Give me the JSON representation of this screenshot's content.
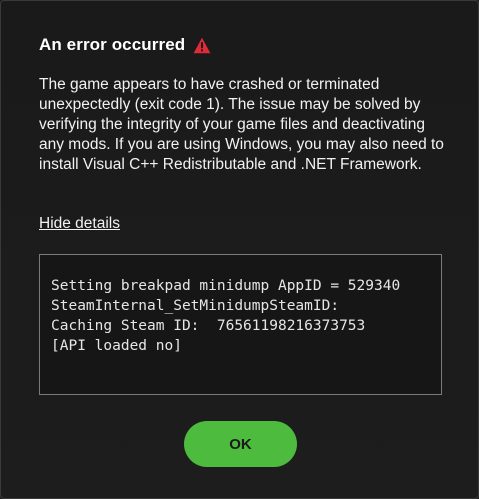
{
  "dialog": {
    "title": "An error occurred",
    "title_icon": "warning-triangle-icon",
    "accent_color": "#e02a3a",
    "message": "The game appears to have crashed or terminated unexpectedly (exit code 1). The issue may be solved by verifying the integrity of your game files and deactivating any mods. If you are using Windows, you may also need to install Visual C++ Redistributable and .NET Framework.",
    "details_toggle_label": "Hide details",
    "details_text": "Setting breakpad minidump AppID = 529340\nSteamInternal_SetMinidumpSteamID:\nCaching Steam ID:  76561198216373753\n[API loaded no]",
    "ok_label": "OK",
    "ok_color": "#4dbb3d"
  }
}
